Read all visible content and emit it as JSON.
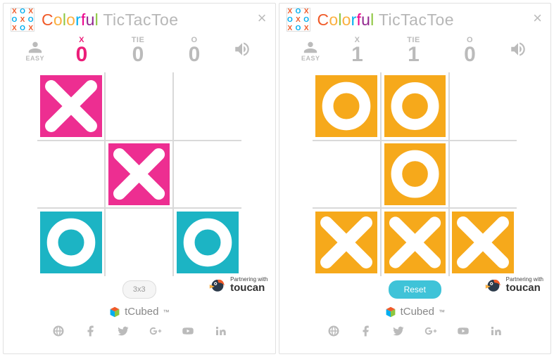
{
  "title": {
    "colorful_letters": [
      "C",
      "o",
      "l",
      "o",
      "r",
      "f",
      "u",
      "l"
    ],
    "rest": " TicTacToe"
  },
  "panels": [
    {
      "difficulty": "EASY",
      "scores": {
        "x": {
          "label": "X",
          "value": "0",
          "active": true
        },
        "tie": {
          "label": "TIE",
          "value": "0",
          "active": false
        },
        "o": {
          "label": "O",
          "value": "0",
          "active": false
        }
      },
      "board": [
        {
          "mark": "X",
          "color": "pink"
        },
        {
          "mark": "",
          "color": ""
        },
        {
          "mark": "",
          "color": ""
        },
        {
          "mark": "",
          "color": ""
        },
        {
          "mark": "X",
          "color": "pink"
        },
        {
          "mark": "",
          "color": ""
        },
        {
          "mark": "O",
          "color": "teal"
        },
        {
          "mark": "",
          "color": ""
        },
        {
          "mark": "O",
          "color": "teal"
        }
      ],
      "button": {
        "label": "3x3",
        "style": "plain"
      }
    },
    {
      "difficulty": "EASY",
      "scores": {
        "x": {
          "label": "X",
          "value": "1",
          "active": false
        },
        "tie": {
          "label": "TIE",
          "value": "1",
          "active": false
        },
        "o": {
          "label": "O",
          "value": "0",
          "active": false
        }
      },
      "board": [
        {
          "mark": "O",
          "color": "orange"
        },
        {
          "mark": "O",
          "color": "orange"
        },
        {
          "mark": "",
          "color": ""
        },
        {
          "mark": "",
          "color": ""
        },
        {
          "mark": "O",
          "color": "orange"
        },
        {
          "mark": "",
          "color": ""
        },
        {
          "mark": "X",
          "color": "orange"
        },
        {
          "mark": "X",
          "color": "orange"
        },
        {
          "mark": "X",
          "color": "orange"
        }
      ],
      "button": {
        "label": "Reset",
        "style": "reset"
      }
    }
  ],
  "partner": {
    "line1": "Partnering with",
    "line2": "toucan"
  },
  "brand": "tCubed",
  "social_icons": [
    "globe",
    "facebook",
    "twitter",
    "googleplus",
    "youtube",
    "linkedin"
  ]
}
